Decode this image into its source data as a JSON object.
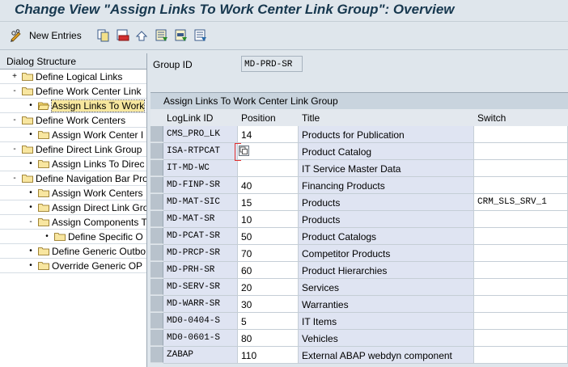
{
  "window": {
    "title": "Change View \"Assign Links To Work Center Link Group\": Overview"
  },
  "toolbar": {
    "new_entries_label": "New Entries",
    "icons": [
      "pencil-glasses-icon",
      "copy-icon",
      "delete-icon",
      "undo-icon",
      "select-all-icon",
      "select-block-icon",
      "deselect-all-icon"
    ]
  },
  "tree": {
    "header": "Dialog Structure",
    "items": [
      {
        "label": "Define Logical Links"
      },
      {
        "label": "Define Work Center Link"
      },
      {
        "label": "Assign Links To Work"
      },
      {
        "label": "Define Work Centers"
      },
      {
        "label": "Assign Work Center I"
      },
      {
        "label": "Define Direct Link Group"
      },
      {
        "label": "Assign Links To Direc"
      },
      {
        "label": "Define Navigation Bar Pro"
      },
      {
        "label": "Assign Work Centers"
      },
      {
        "label": "Assign Direct Link Gro"
      },
      {
        "label": "Assign Components T"
      },
      {
        "label": "Define Specific O"
      },
      {
        "label": "Define Generic Outbo"
      },
      {
        "label": "Override Generic OP"
      }
    ]
  },
  "group": {
    "label": "Group ID",
    "value": "MD-PRD-SR"
  },
  "table": {
    "title": "Assign Links To Work Center Link Group",
    "columns": [
      "LogLink ID",
      "Position",
      "Title",
      "Switch"
    ],
    "rows": [
      {
        "id": "CMS_PRO_LK",
        "pos": "14",
        "title": "Products for Publication",
        "switch": ""
      },
      {
        "id": "ISA-RTPCAT",
        "pos": "",
        "title": "Product Catalog",
        "switch": ""
      },
      {
        "id": "IT-MD-WC",
        "pos": "",
        "title": "IT Service Master Data",
        "switch": ""
      },
      {
        "id": "MD-FINP-SR",
        "pos": "40",
        "title": "Financing Products",
        "switch": ""
      },
      {
        "id": "MD-MAT-SIC",
        "pos": "15",
        "title": "Products",
        "switch": "CRM_SLS_SRV_1"
      },
      {
        "id": "MD-MAT-SR",
        "pos": "10",
        "title": "Products",
        "switch": ""
      },
      {
        "id": "MD-PCAT-SR",
        "pos": "50",
        "title": "Product Catalogs",
        "switch": ""
      },
      {
        "id": "MD-PRCP-SR",
        "pos": "70",
        "title": "Competitor Products",
        "switch": ""
      },
      {
        "id": "MD-PRH-SR",
        "pos": "60",
        "title": "Product Hierarchies",
        "switch": ""
      },
      {
        "id": "MD-SERV-SR",
        "pos": "20",
        "title": "Services",
        "switch": ""
      },
      {
        "id": "MD-WARR-SR",
        "pos": "30",
        "title": "Warranties",
        "switch": ""
      },
      {
        "id": "MD0-0404-S",
        "pos": "5",
        "title": "IT Items",
        "switch": ""
      },
      {
        "id": "MD0-0601-S",
        "pos": "80",
        "title": "Vehicles",
        "switch": ""
      },
      {
        "id": "ZABAP",
        "pos": "110",
        "title": "External ABAP webdyn component",
        "switch": ""
      }
    ]
  }
}
